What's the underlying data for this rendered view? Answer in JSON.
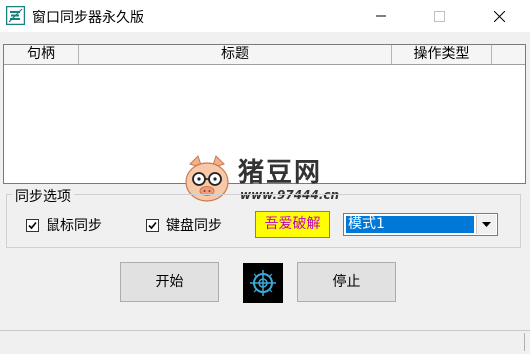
{
  "window": {
    "title": "窗口同步器永久版"
  },
  "list": {
    "columns": [
      "句柄",
      "标题",
      "操作类型"
    ]
  },
  "watermark": {
    "name": "猪豆网",
    "url": "www.97444.cn"
  },
  "sync_options": {
    "group_label": "同步选项",
    "mouse_sync": {
      "label": "鼠标同步",
      "checked": true
    },
    "keyboard_sync": {
      "label": "键盘同步",
      "checked": true
    },
    "crack_label": "吾爱破解",
    "mode_select": {
      "value": "模式1"
    }
  },
  "buttons": {
    "start": "开始",
    "stop": "停止"
  },
  "colors": {
    "selection": "#0078d7",
    "crack_bg": "#ffff00",
    "crack_text": "#c000c0",
    "app_icon": "#1a7f7f"
  }
}
